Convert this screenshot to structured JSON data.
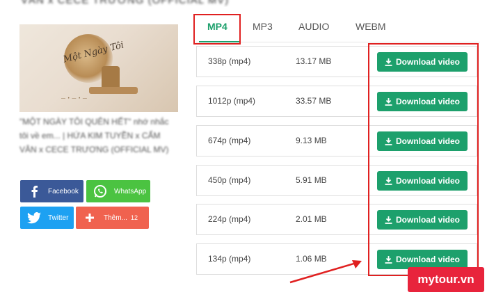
{
  "page": {
    "blurred_heading": "VÂN x CECE TRƯƠNG (OFFICIAL MV)"
  },
  "video": {
    "thumbnail_script": "Một Ngày Tôi",
    "thumbnail_caption": "— • — • —",
    "title": "\"MỘT NGÀY TÔI QUÊN HẾT\" nhớ nhắc tôi về em... | HỨA KIM TUYỀN x CẨM VÂN x CECE TRƯƠNG (OFFICIAL MV)"
  },
  "share": {
    "facebook": "Facebook",
    "whatsapp": "WhatsApp",
    "twitter": "Twitter",
    "more": "Thêm...",
    "more_count": "12"
  },
  "tabs": [
    {
      "label": "MP4",
      "active": true
    },
    {
      "label": "MP3",
      "active": false
    },
    {
      "label": "AUDIO",
      "active": false
    },
    {
      "label": "WEBM",
      "active": false
    }
  ],
  "downloads": [
    {
      "quality": "338p (mp4)",
      "size": "13.17 MB",
      "button": "Download video"
    },
    {
      "quality": "1012p (mp4)",
      "size": "33.57 MB",
      "button": "Download video"
    },
    {
      "quality": "674p (mp4)",
      "size": "9.13 MB",
      "button": "Download video"
    },
    {
      "quality": "450p (mp4)",
      "size": "5.91 MB",
      "button": "Download video"
    },
    {
      "quality": "224p (mp4)",
      "size": "2.01 MB",
      "button": "Download video"
    },
    {
      "quality": "134p (mp4)",
      "size": "1.06 MB",
      "button": "Download video"
    }
  ],
  "watermark": "mytour.vn",
  "colors": {
    "accent": "#1da06c",
    "highlight": "#e02020",
    "facebook": "#3b5998",
    "whatsapp": "#4bc341",
    "twitter": "#1da1f2",
    "more": "#f0624f"
  }
}
